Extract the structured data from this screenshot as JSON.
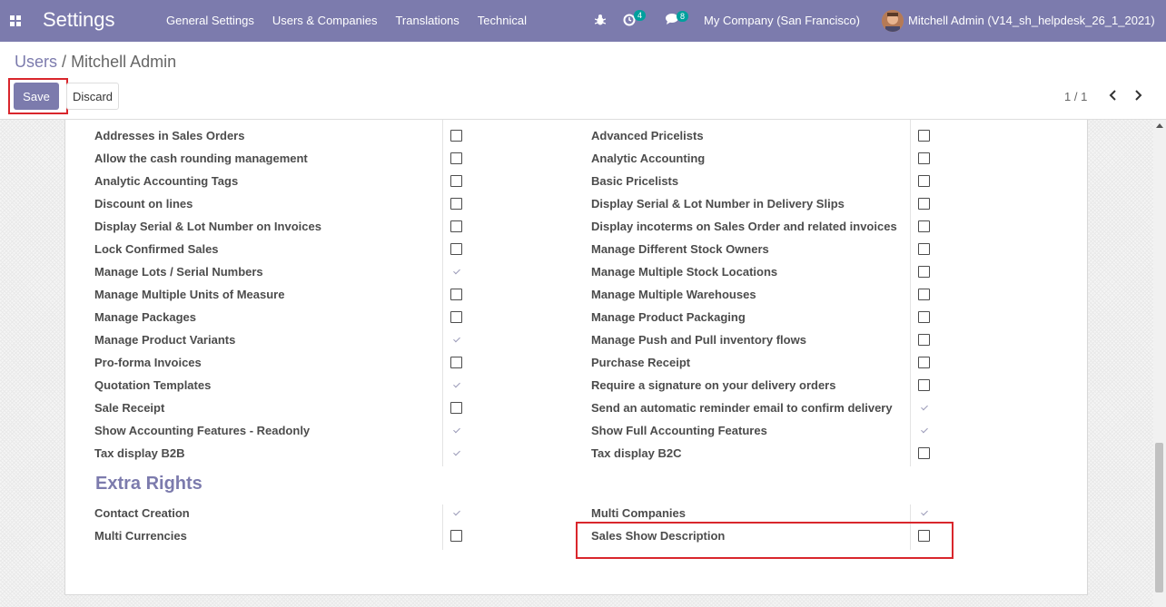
{
  "navbar": {
    "app_title": "Settings",
    "menu": [
      "General Settings",
      "Users & Companies",
      "Translations",
      "Technical"
    ],
    "activity_count": "4",
    "message_count": "8",
    "company": "My Company (San Francisco)",
    "user": "Mitchell Admin (V14_sh_helpdesk_26_1_2021)"
  },
  "breadcrumb": {
    "parent": "Users",
    "separator": "/",
    "current": "Mitchell Admin"
  },
  "actions": {
    "save": "Save",
    "discard": "Discard"
  },
  "pager": {
    "value": "1 / 1"
  },
  "technical_settings": {
    "left": [
      {
        "label": "Addresses in Sales Orders",
        "checked": false
      },
      {
        "label": "Allow the cash rounding management",
        "checked": false
      },
      {
        "label": "Analytic Accounting Tags",
        "checked": false
      },
      {
        "label": "Discount on lines",
        "checked": false
      },
      {
        "label": "Display Serial & Lot Number on Invoices",
        "checked": false
      },
      {
        "label": "Lock Confirmed Sales",
        "checked": false
      },
      {
        "label": "Manage Lots / Serial Numbers",
        "checked": true
      },
      {
        "label": "Manage Multiple Units of Measure",
        "checked": false
      },
      {
        "label": "Manage Packages",
        "checked": false
      },
      {
        "label": "Manage Product Variants",
        "checked": true
      },
      {
        "label": "Pro-forma Invoices",
        "checked": false
      },
      {
        "label": "Quotation Templates",
        "checked": true
      },
      {
        "label": "Sale Receipt",
        "checked": false
      },
      {
        "label": "Show Accounting Features - Readonly",
        "checked": true
      },
      {
        "label": "Tax display B2B",
        "checked": true
      }
    ],
    "right": [
      {
        "label": "Advanced Pricelists",
        "checked": false
      },
      {
        "label": "Analytic Accounting",
        "checked": false
      },
      {
        "label": "Basic Pricelists",
        "checked": false
      },
      {
        "label": "Display Serial & Lot Number in Delivery Slips",
        "checked": false
      },
      {
        "label": "Display incoterms on Sales Order and related invoices",
        "checked": false
      },
      {
        "label": "Manage Different Stock Owners",
        "checked": false
      },
      {
        "label": "Manage Multiple Stock Locations",
        "checked": false
      },
      {
        "label": "Manage Multiple Warehouses",
        "checked": false
      },
      {
        "label": "Manage Product Packaging",
        "checked": false
      },
      {
        "label": "Manage Push and Pull inventory flows",
        "checked": false
      },
      {
        "label": "Purchase Receipt",
        "checked": false
      },
      {
        "label": "Require a signature on your delivery orders",
        "checked": false
      },
      {
        "label": "Send an automatic reminder email to confirm delivery",
        "checked": true
      },
      {
        "label": "Show Full Accounting Features",
        "checked": true
      },
      {
        "label": "Tax display B2C",
        "checked": false
      }
    ]
  },
  "extra_rights": {
    "title": "Extra Rights",
    "left": [
      {
        "label": "Contact Creation",
        "checked": true
      },
      {
        "label": "Multi Currencies",
        "checked": false
      }
    ],
    "right": [
      {
        "label": "Multi Companies",
        "checked": true
      },
      {
        "label": "Sales Show Description",
        "checked": false
      }
    ]
  },
  "colors": {
    "navbar": "#7c7bad",
    "accent": "#7c7bad",
    "highlight": "#d9262c"
  }
}
